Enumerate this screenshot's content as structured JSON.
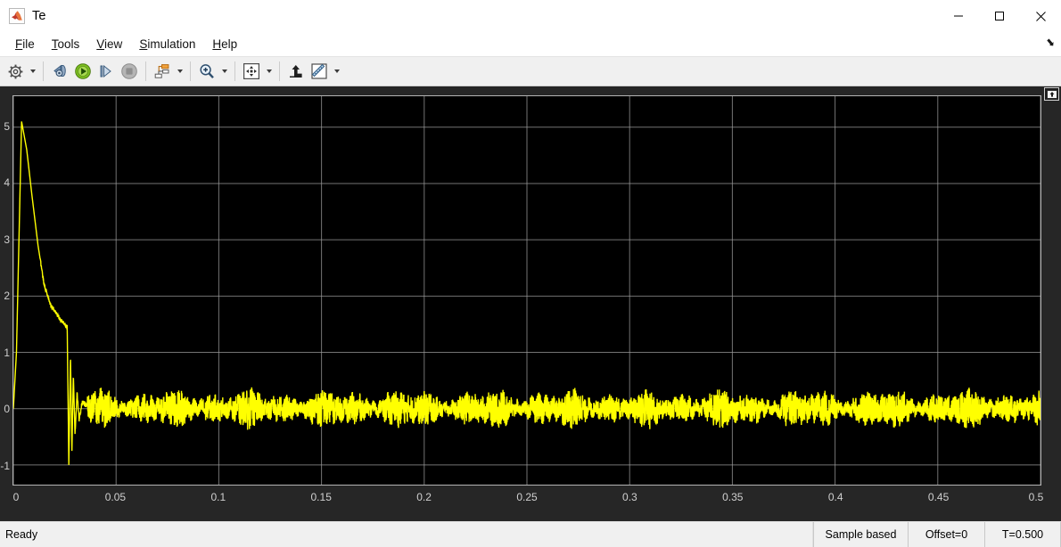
{
  "window": {
    "title": "Te",
    "icon": "matlab-icon",
    "controls": {
      "minimize": "minimize-icon",
      "maximize": "maximize-icon",
      "close": "close-icon"
    }
  },
  "menubar": {
    "items": [
      {
        "label": "File",
        "mnemonic": "F"
      },
      {
        "label": "Tools",
        "mnemonic": "T"
      },
      {
        "label": "View",
        "mnemonic": "V"
      },
      {
        "label": "Simulation",
        "mnemonic": "S"
      },
      {
        "label": "Help",
        "mnemonic": "H"
      }
    ],
    "overflow": "menu-overflow-arrow"
  },
  "toolbar": {
    "buttons": [
      {
        "name": "configuration-properties-icon",
        "tooltip": "Configuration Properties",
        "has_dropdown": true
      },
      {
        "name": "step-back-icon",
        "tooltip": "Step Back",
        "has_dropdown": false
      },
      {
        "name": "run-icon",
        "tooltip": "Run",
        "has_dropdown": false
      },
      {
        "name": "step-forward-icon",
        "tooltip": "Step Forward",
        "has_dropdown": false
      },
      {
        "name": "stop-icon",
        "tooltip": "Stop",
        "has_dropdown": false
      },
      {
        "name": "signal-selector-icon",
        "tooltip": "Signal Selection",
        "has_dropdown": true
      },
      {
        "name": "zoom-in-icon",
        "tooltip": "Zoom In",
        "has_dropdown": true
      },
      {
        "name": "pan-fit-icon",
        "tooltip": "Autoscale",
        "has_dropdown": true
      },
      {
        "name": "cursor-measurements-icon",
        "tooltip": "Cursor Measurements",
        "has_dropdown": false
      },
      {
        "name": "measurements-icon",
        "tooltip": "Measurements",
        "has_dropdown": true
      }
    ]
  },
  "plot": {
    "maximize_axes_button": "maximize-axes-icon",
    "background": "#000000",
    "grid_color": "#9a9a9a",
    "trace_color": "#ffff00",
    "panel_color": "#262626"
  },
  "statusbar": {
    "message": "Ready",
    "sample_mode": "Sample based",
    "offset": "Offset=0",
    "time": "T=0.500"
  },
  "chart_data": {
    "type": "line",
    "title": "Te",
    "xlabel": "",
    "ylabel": "",
    "xlim": [
      0,
      0.5
    ],
    "ylim": [
      -1.35,
      5.55
    ],
    "grid": true,
    "legend": "none",
    "xticks": [
      0,
      0.05,
      0.1,
      0.15,
      0.2,
      0.25,
      0.3,
      0.35,
      0.4,
      0.45,
      0.5
    ],
    "xticklabels": [
      "0",
      "0.05",
      "0.1",
      "0.15",
      "0.2",
      "0.25",
      "0.3",
      "0.35",
      "0.4",
      "0.45",
      "0.5"
    ],
    "yticks": [
      -1,
      0,
      1,
      2,
      3,
      4,
      5
    ],
    "yticklabels": [
      "-1",
      "0",
      "1",
      "2",
      "3",
      "4",
      "5"
    ],
    "series": [
      {
        "name": "Te",
        "color": "#ffff00",
        "description": "Electromagnetic torque startup transient: rises from 0 to a peak of 5.1 at t=0.004, decays to ~1.5 by t=0.026, drops sharply to -1.0 with damped ringing until t=0.035, then settles to noisy steady state around 0 with +/-0.25 ripple.",
        "keypoints_x": [
          0,
          0.0015,
          0.004,
          0.0065,
          0.009,
          0.012,
          0.015,
          0.018,
          0.0205,
          0.0225,
          0.0245,
          0.0262,
          0.027,
          0.0278,
          0.0285,
          0.0292,
          0.03,
          0.031,
          0.032,
          0.0335,
          0.036,
          0.04,
          0.05,
          0.5
        ],
        "keypoints_y": [
          0,
          1.0,
          5.1,
          4.6,
          3.8,
          2.9,
          2.2,
          1.85,
          1.72,
          1.6,
          1.52,
          1.45,
          -1.0,
          0.95,
          -0.75,
          0.6,
          -0.45,
          0.3,
          -0.2,
          0.12,
          0.05,
          0.02,
          0.0,
          0.0
        ],
        "peak": {
          "x": 0.004,
          "y": 5.1
        },
        "min": {
          "x": 0.027,
          "y": -1.0
        },
        "steady_state_mean": 0.0,
        "steady_state_ripple": 0.22
      }
    ]
  }
}
